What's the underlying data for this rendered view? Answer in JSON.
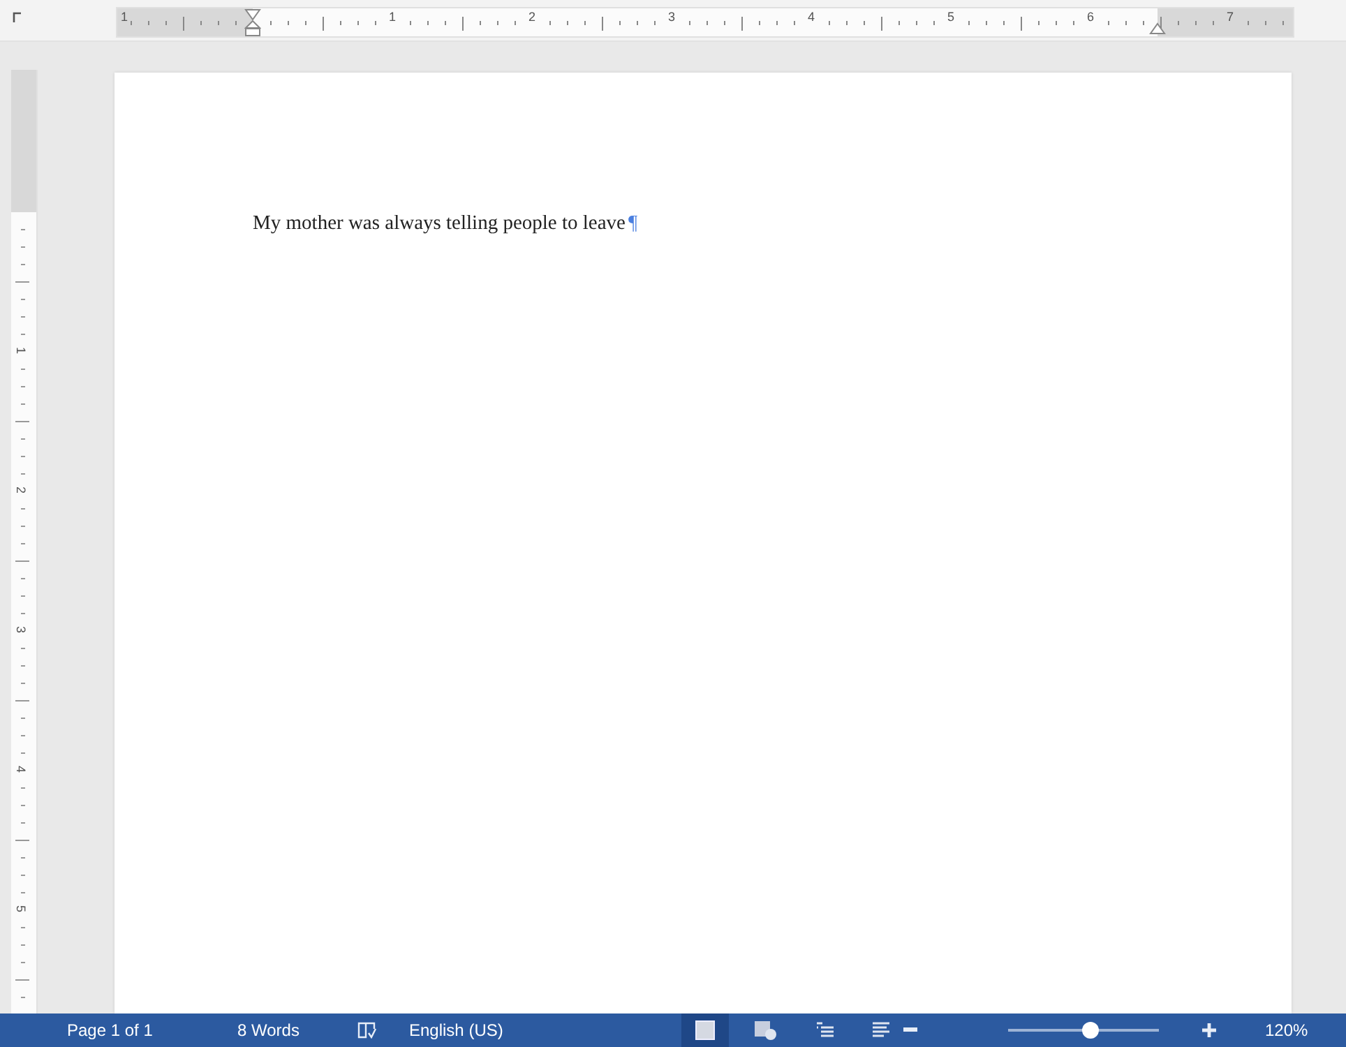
{
  "top_ruler": {
    "labels": [
      "1",
      "1",
      "2",
      "3",
      "4",
      "5",
      "6",
      "7"
    ]
  },
  "left_ruler": {
    "labels": [
      "1",
      "2",
      "3",
      "4",
      "5"
    ]
  },
  "document": {
    "paragraphs": [
      {
        "text": "My mother was always telling people to leave",
        "mark": "¶"
      }
    ]
  },
  "status_bar": {
    "page": "Page 1 of 1",
    "words": "8 Words",
    "language": "English (US)",
    "views": [
      {
        "kind": "print",
        "selected": true
      },
      {
        "kind": "web",
        "selected": false
      },
      {
        "kind": "outline",
        "selected": false
      },
      {
        "kind": "draft",
        "selected": false
      }
    ],
    "zoom": {
      "level": 0.55,
      "percent": "120%"
    }
  }
}
